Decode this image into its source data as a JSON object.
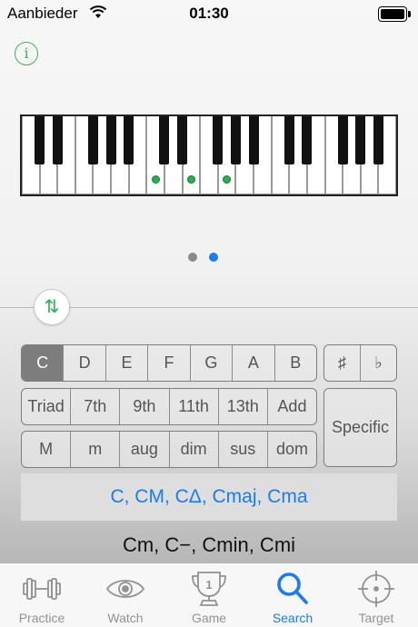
{
  "status_bar": {
    "carrier": "Aanbieder",
    "time": "01:30"
  },
  "info_button": {
    "label": "i"
  },
  "keyboard": {
    "white_keys": 21,
    "active_notes": [
      "C",
      "E",
      "G"
    ],
    "dot_color": "#22b24c"
  },
  "pager": {
    "pages": 2,
    "current": 2
  },
  "swap_button": {
    "label": "⇅"
  },
  "note_selector": {
    "options": [
      "C",
      "D",
      "E",
      "F",
      "G",
      "A",
      "B"
    ],
    "selected": "C"
  },
  "accidentals": {
    "options": [
      "♯",
      "♭"
    ]
  },
  "chord_types": {
    "options": [
      "Triad",
      "7th",
      "9th",
      "11th",
      "13th",
      "Add"
    ]
  },
  "qualities": {
    "options": [
      "M",
      "m",
      "aug",
      "dim",
      "sus",
      "dom"
    ]
  },
  "specific_button": {
    "label": "Specific"
  },
  "result": {
    "primary": "C, CM, CΔ, Cmaj, Cma",
    "secondary": "Cm, C−, Cmin, Cmi"
  },
  "tab_bar": {
    "tabs": [
      {
        "label": "Practice",
        "icon": "dumbbell-icon"
      },
      {
        "label": "Watch",
        "icon": "eye-icon"
      },
      {
        "label": "Game",
        "icon": "trophy-icon",
        "badge": "1"
      },
      {
        "label": "Search",
        "icon": "search-icon"
      },
      {
        "label": "Target",
        "icon": "crosshair-icon"
      }
    ],
    "active": "Search"
  },
  "colors": {
    "accent": "#1a7cf2",
    "green": "#3cb45a",
    "inactive": "#929292"
  }
}
